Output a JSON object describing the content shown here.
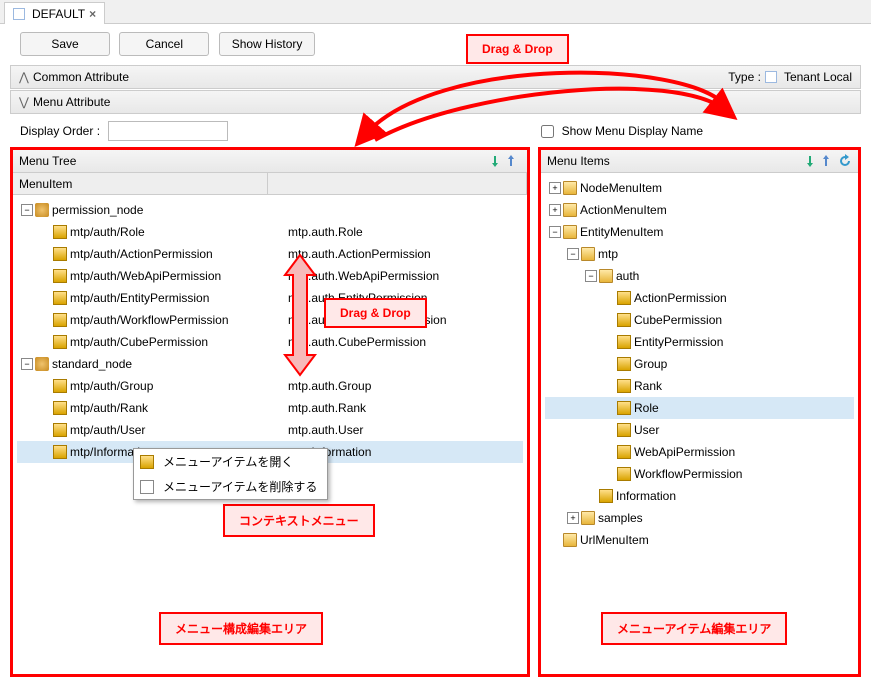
{
  "tab": {
    "title": "DEFAULT",
    "close": "×"
  },
  "buttons": {
    "save": "Save",
    "cancel": "Cancel",
    "history": "Show History"
  },
  "sections": {
    "common": "Common Attribute",
    "menu": "Menu Attribute",
    "type_label": "Type :",
    "type_value": "Tenant Local"
  },
  "attrs": {
    "display_order_label": "Display Order :",
    "display_order_value": "",
    "show_menu_display_name": "Show Menu Display Name"
  },
  "panels": {
    "left_title": "Menu Tree",
    "right_title": "Menu Items",
    "col_header": "MenuItem"
  },
  "left_tree": [
    {
      "depth": 0,
      "toggle": "-",
      "icon": "node",
      "label": "permission_node",
      "l2": ""
    },
    {
      "depth": 1,
      "toggle": "",
      "icon": "box",
      "label": "mtp/auth/Role",
      "l2": "mtp.auth.Role"
    },
    {
      "depth": 1,
      "toggle": "",
      "icon": "box",
      "label": "mtp/auth/ActionPermission",
      "l2": "mtp.auth.ActionPermission"
    },
    {
      "depth": 1,
      "toggle": "",
      "icon": "box",
      "label": "mtp/auth/WebApiPermission",
      "l2": "mtp.auth.WebApiPermission"
    },
    {
      "depth": 1,
      "toggle": "",
      "icon": "box",
      "label": "mtp/auth/EntityPermission",
      "l2": "mtp.auth.EntityPermission"
    },
    {
      "depth": 1,
      "toggle": "",
      "icon": "box",
      "label": "mtp/auth/WorkflowPermission",
      "l2": "mtp.auth.WorkflowPermission"
    },
    {
      "depth": 1,
      "toggle": "",
      "icon": "box",
      "label": "mtp/auth/CubePermission",
      "l2": "mtp.auth.CubePermission"
    },
    {
      "depth": 0,
      "toggle": "-",
      "icon": "node",
      "label": "standard_node",
      "l2": ""
    },
    {
      "depth": 1,
      "toggle": "",
      "icon": "box",
      "label": "mtp/auth/Group",
      "l2": "mtp.auth.Group"
    },
    {
      "depth": 1,
      "toggle": "",
      "icon": "box",
      "label": "mtp/auth/Rank",
      "l2": "mtp.auth.Rank"
    },
    {
      "depth": 1,
      "toggle": "",
      "icon": "box",
      "label": "mtp/auth/User",
      "l2": "mtp.auth.User"
    },
    {
      "depth": 1,
      "toggle": "",
      "icon": "box",
      "label": "mtp/Information",
      "l2": "mtp.Information",
      "selected": true
    }
  ],
  "right_tree": [
    {
      "depth": 0,
      "toggle": "+",
      "icon": "folder",
      "label": "NodeMenuItem"
    },
    {
      "depth": 0,
      "toggle": "+",
      "icon": "folder",
      "label": "ActionMenuItem"
    },
    {
      "depth": 0,
      "toggle": "-",
      "icon": "folder",
      "label": "EntityMenuItem"
    },
    {
      "depth": 1,
      "toggle": "-",
      "icon": "folder",
      "label": "mtp"
    },
    {
      "depth": 2,
      "toggle": "-",
      "icon": "folder",
      "label": "auth"
    },
    {
      "depth": 3,
      "toggle": "",
      "icon": "box",
      "label": "ActionPermission"
    },
    {
      "depth": 3,
      "toggle": "",
      "icon": "box",
      "label": "CubePermission"
    },
    {
      "depth": 3,
      "toggle": "",
      "icon": "box",
      "label": "EntityPermission"
    },
    {
      "depth": 3,
      "toggle": "",
      "icon": "box",
      "label": "Group"
    },
    {
      "depth": 3,
      "toggle": "",
      "icon": "box",
      "label": "Rank"
    },
    {
      "depth": 3,
      "toggle": "",
      "icon": "box",
      "label": "Role",
      "selected": true
    },
    {
      "depth": 3,
      "toggle": "",
      "icon": "box",
      "label": "User"
    },
    {
      "depth": 3,
      "toggle": "",
      "icon": "box",
      "label": "WebApiPermission"
    },
    {
      "depth": 3,
      "toggle": "",
      "icon": "box",
      "label": "WorkflowPermission"
    },
    {
      "depth": 2,
      "toggle": "",
      "icon": "box",
      "label": "Information"
    },
    {
      "depth": 1,
      "toggle": "+",
      "icon": "folder",
      "label": "samples"
    },
    {
      "depth": 0,
      "toggle": "",
      "icon": "folder",
      "label": "UrlMenuItem"
    }
  ],
  "context_menu": {
    "open": "メニューアイテムを開く",
    "delete": "メニューアイテムを削除する"
  },
  "callouts": {
    "dragdrop": "Drag & Drop",
    "context": "コンテキストメニュー",
    "left_area": "メニュー構成編集エリア",
    "right_area": "メニューアイテム編集エリア"
  }
}
